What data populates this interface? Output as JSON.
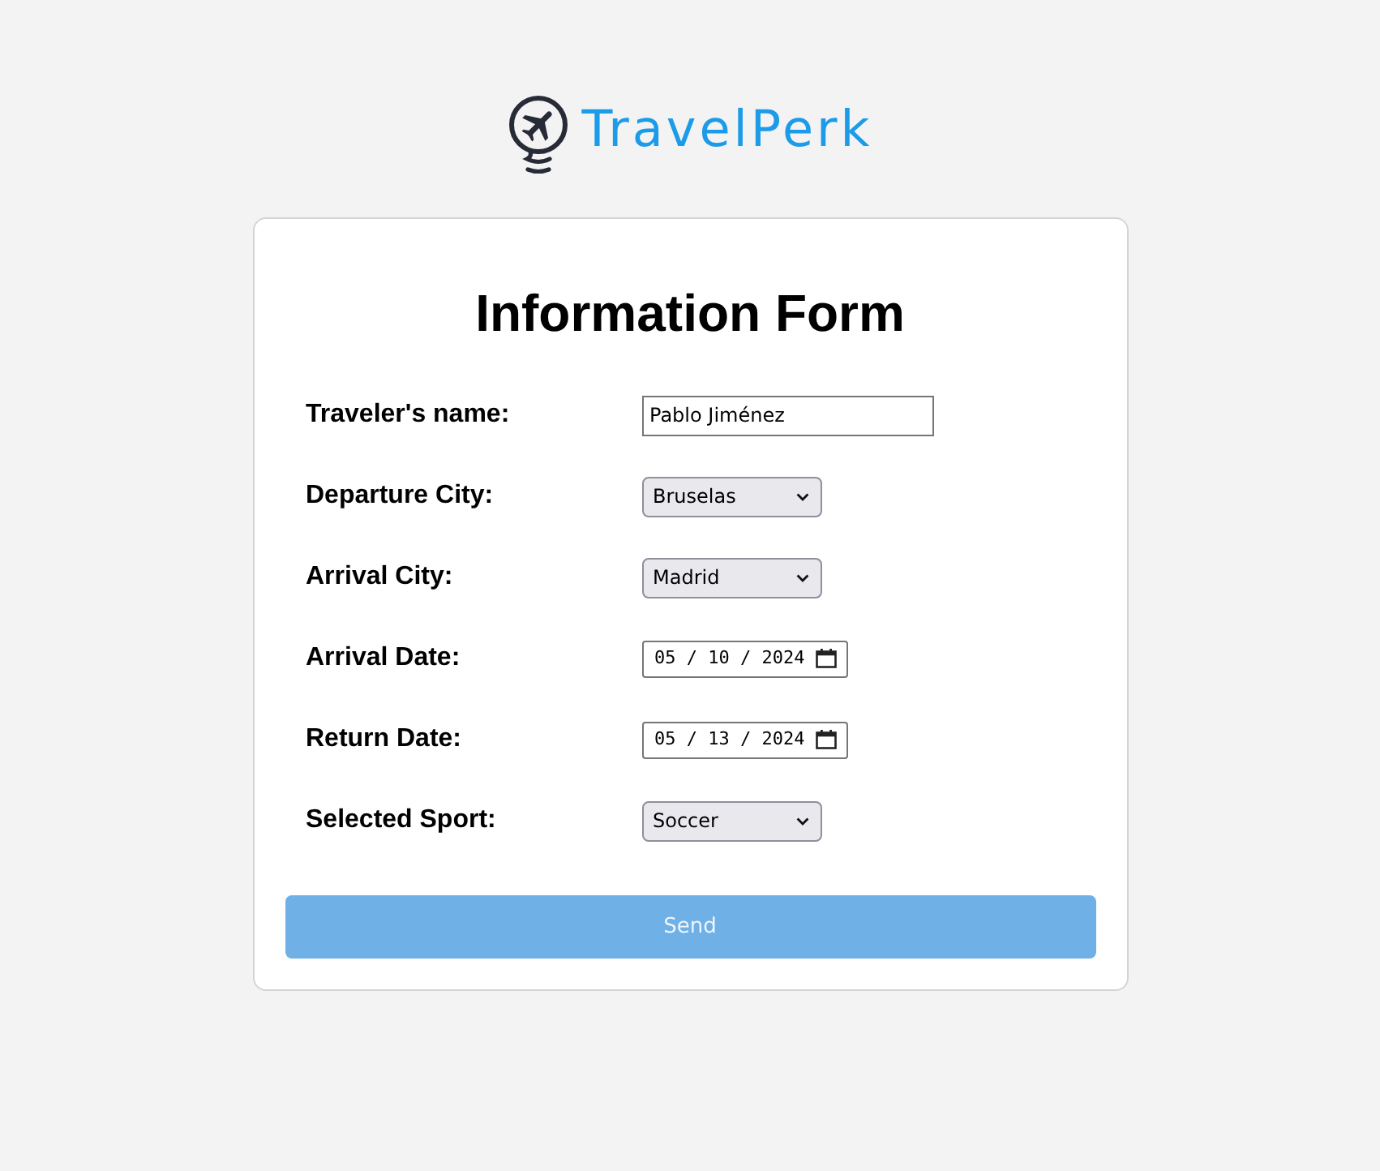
{
  "logo": {
    "text": "TravelPerk"
  },
  "form": {
    "title": "Information Form",
    "fields": [
      {
        "kind": "text",
        "label": "Traveler's name:",
        "value": "Pablo Jiménez"
      },
      {
        "kind": "select",
        "label": "Departure City:",
        "value": "Bruselas"
      },
      {
        "kind": "select",
        "label": "Arrival City:",
        "value": "Madrid"
      },
      {
        "kind": "date",
        "label": "Arrival Date:",
        "value": "05 / 10 / 2024"
      },
      {
        "kind": "date",
        "label": "Return Date:",
        "value": "05 / 13 / 2024"
      },
      {
        "kind": "select",
        "label": "Selected Sport:",
        "value": "Soccer"
      }
    ],
    "submit": {
      "label": "Send",
      "disabled": true
    }
  }
}
